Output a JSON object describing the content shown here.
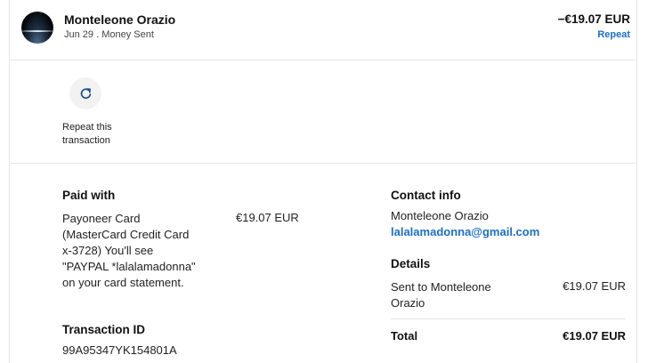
{
  "transaction": {
    "name": "Monteleone Orazio",
    "subtitle": "Jun 29 . Money Sent",
    "amount": "−€19.07 EUR",
    "repeat_link": "Repeat"
  },
  "repeat_action": {
    "icon": "refresh-icon",
    "label": "Repeat this transaction"
  },
  "paid_with": {
    "heading": "Paid with",
    "method": "Payoneer Card (MasterCard Credit Card x-3728) You'll see \"PAYPAL *lalalamadonna\" on your card statement.",
    "amount": "€19.07 EUR"
  },
  "transaction_id": {
    "heading": "Transaction ID",
    "value": "99A95347YK154801A"
  },
  "contact": {
    "heading": "Contact info",
    "name": "Monteleone Orazio",
    "email": "lalalamadonna@gmail.com"
  },
  "details": {
    "heading": "Details",
    "sent_to": "Sent to Monteleone Orazio",
    "sent_amount": "€19.07 EUR",
    "total_label": "Total",
    "total_amount": "€19.07 EUR"
  },
  "colors": {
    "link": "#1d6fc8",
    "divider": "#e6e6e6"
  }
}
